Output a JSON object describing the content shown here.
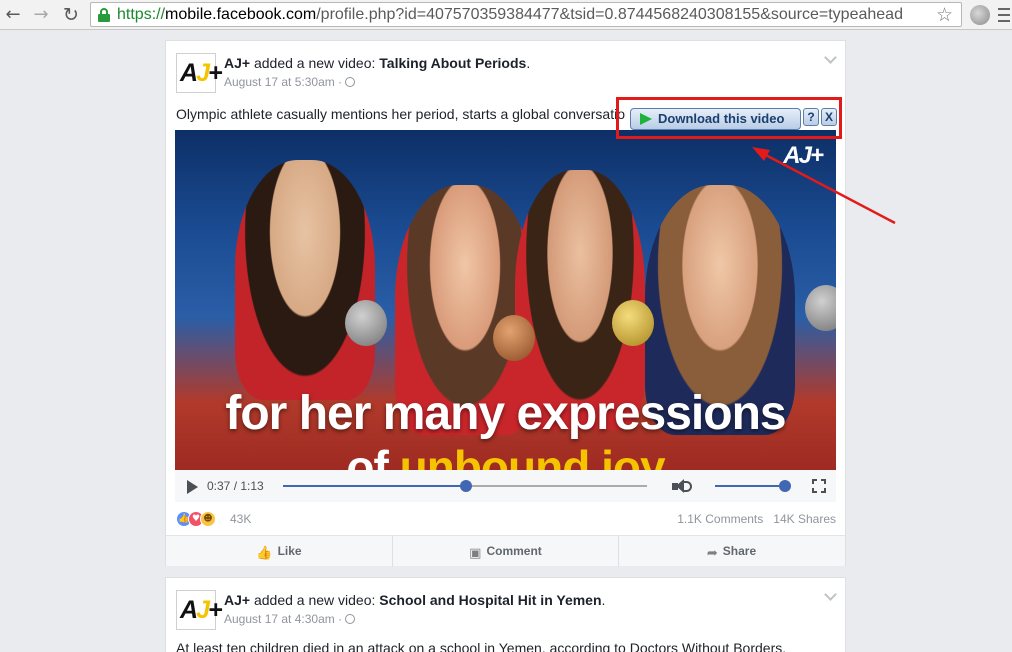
{
  "browser": {
    "url_scheme": "https://",
    "url_host": "mobile.facebook.com",
    "url_rest": "/profile.php?id=407570359384477&tsid=0.8744568240308155&source=typeahead",
    "back_icon": "arrow-left-icon",
    "forward_icon": "arrow-right-icon",
    "reload_icon": "reload-icon",
    "lock_color": "#2b9a3c"
  },
  "post1": {
    "page_name": "AJ+",
    "verb": " added a new video: ",
    "video_title": "Talking About Periods",
    "title_end": ".",
    "date": "August 17 at 5:30am · ",
    "text": "Olympic athlete casually mentions her period, starts a global conversation.",
    "video": {
      "logo": "AJ+",
      "caption_line1": "for her many expressions",
      "caption_line2_prefix": "of ",
      "caption_line2_highlight": "unbound joy",
      "time": "0:37 / 1:13",
      "progress": 0.502,
      "volume": 1.0
    },
    "reaction_count": "43K",
    "comments": "1.1K Comments",
    "shares": "14K Shares",
    "actions": {
      "like": "Like",
      "comment": "Comment",
      "share": "Share"
    }
  },
  "download_overlay": {
    "button_label": "Download this video",
    "help_label": "?",
    "close_label": "X",
    "highlight_color": "#e21a1a"
  },
  "post2": {
    "page_name": "AJ+",
    "verb": " added a new video: ",
    "video_title": "School and Hospital Hit in Yemen",
    "title_end": ".",
    "date": "August 17 at 4:30am · ",
    "text": "At least ten children died in an attack on a school in Yemen, according to Doctors Without Borders."
  }
}
